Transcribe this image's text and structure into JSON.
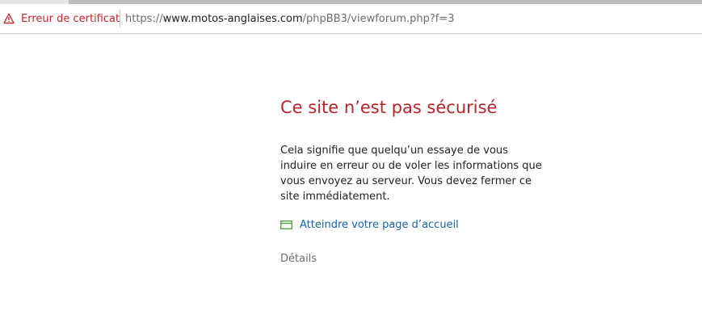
{
  "browser": {
    "cert_error_label": "Erreur de certificat",
    "cert_icon": "warning-triangle-icon",
    "url_scheme": "https://",
    "url_domain": "www.motos-anglaises.com",
    "url_path": "/phpBB3/viewforum.php?f=3"
  },
  "page": {
    "title": "Ce site n’est pas sécurisé",
    "message": "Cela signifie que quelqu’un essaye de vous induire en erreur ou de voler les informations que vous envoyez au serveur. Vous devez fermer ce site immédiatement.",
    "home_link_label": "Atteindre votre page d’accueil",
    "home_link_icon": "home-page-icon",
    "details_label": "Détails"
  },
  "colors": {
    "error_red": "#c0262d",
    "link_blue": "#1565a8",
    "home_icon_green": "#4a9a3a"
  }
}
